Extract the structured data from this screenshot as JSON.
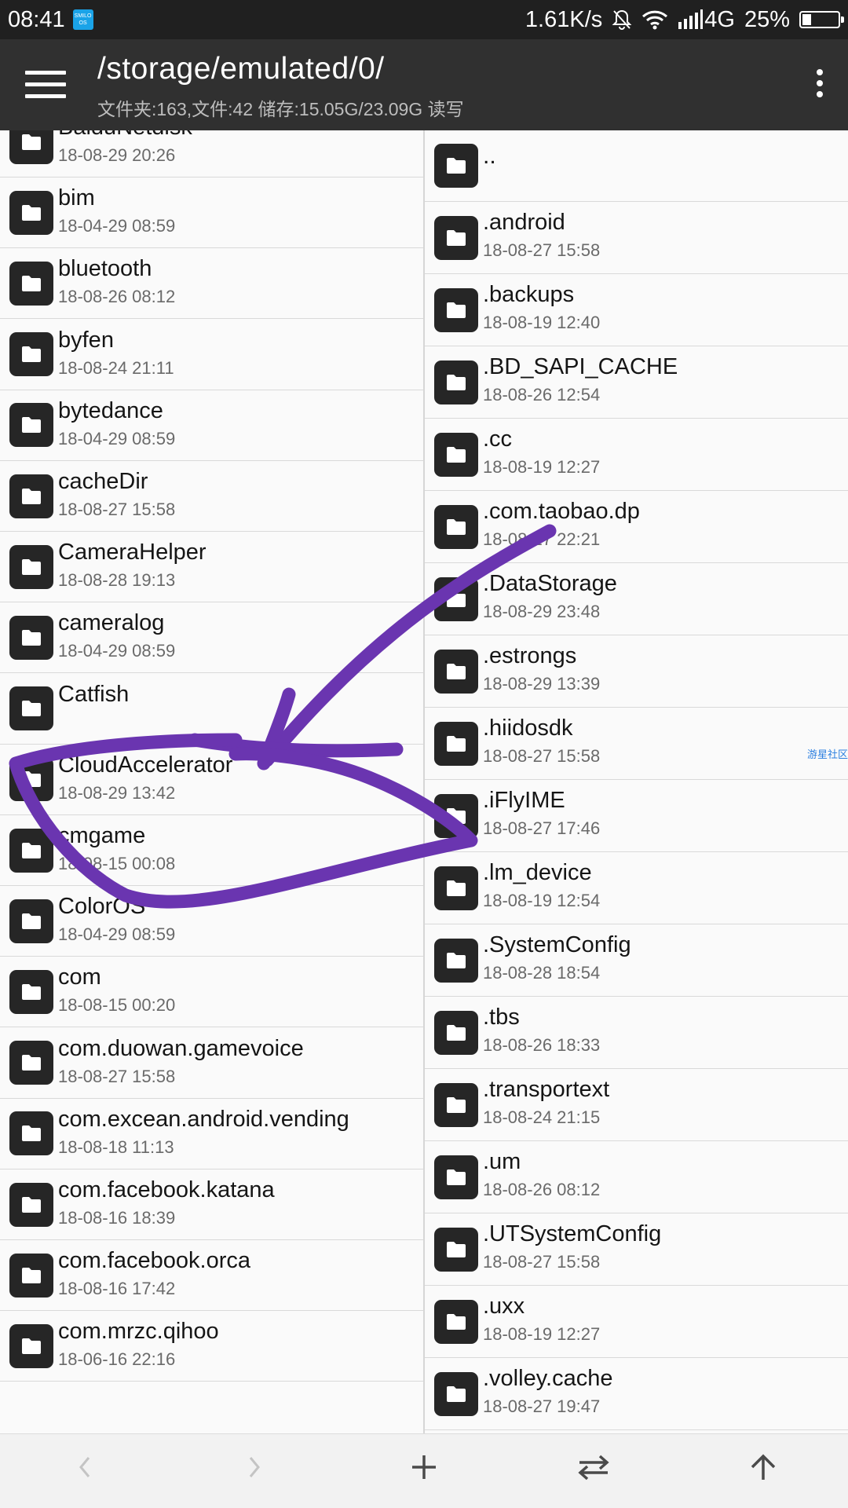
{
  "status_bar": {
    "time": "08:41",
    "os_badge": "SMILO OS",
    "speed": "1.61K/s",
    "network": "4G",
    "battery_percent": "25%",
    "battery_level": 0.25,
    "icons": [
      "mute-bell-icon",
      "wifi-icon",
      "signal-icon",
      "battery-icon"
    ]
  },
  "app_bar": {
    "path": "/storage/emulated/0/",
    "info": "文件夹:163,文件:42  储存:15.05G/23.09G  读写",
    "icons": [
      "menu-icon",
      "more-vert-icon"
    ]
  },
  "left_pane": {
    "items": [
      {
        "name": "BaiduNetdisk",
        "date": "18-08-29 20:26"
      },
      {
        "name": "bim",
        "date": "18-04-29 08:59"
      },
      {
        "name": "bluetooth",
        "date": "18-08-26 08:12"
      },
      {
        "name": "byfen",
        "date": "18-08-24 21:11"
      },
      {
        "name": "bytedance",
        "date": "18-04-29 08:59"
      },
      {
        "name": "cacheDir",
        "date": "18-08-27 15:58"
      },
      {
        "name": "CameraHelper",
        "date": "18-08-28 19:13"
      },
      {
        "name": "cameralog",
        "date": "18-04-29 08:59"
      },
      {
        "name": "Catfish",
        "date": ""
      },
      {
        "name": "CloudAccelerator",
        "date": "18-08-29 13:42"
      },
      {
        "name": "cmgame",
        "date": "18-08-15 00:08"
      },
      {
        "name": "ColorOS",
        "date": "18-04-29 08:59"
      },
      {
        "name": "com",
        "date": "18-08-15 00:20"
      },
      {
        "name": "com.duowan.gamevoice",
        "date": "18-08-27 15:58"
      },
      {
        "name": "com.excean.android.vending",
        "date": "18-08-18 11:13"
      },
      {
        "name": "com.facebook.katana",
        "date": "18-08-16 18:39"
      },
      {
        "name": "com.facebook.orca",
        "date": "18-08-16 17:42"
      },
      {
        "name": "com.mrzc.qihoo",
        "date": "18-06-16 22:16"
      }
    ]
  },
  "right_pane": {
    "parent": "..",
    "items": [
      {
        "name": ".android",
        "date": "18-08-27 15:58"
      },
      {
        "name": ".backups",
        "date": "18-08-19 12:40"
      },
      {
        "name": ".BD_SAPI_CACHE",
        "date": "18-08-26 12:54"
      },
      {
        "name": ".cc",
        "date": "18-08-19 12:27"
      },
      {
        "name": ".com.taobao.dp",
        "date": "18-08-27 22:21"
      },
      {
        "name": ".DataStorage",
        "date": "18-08-29 23:48"
      },
      {
        "name": ".estrongs",
        "date": "18-08-29 13:39"
      },
      {
        "name": ".hiidosdk",
        "date": "18-08-27 15:58"
      },
      {
        "name": ".iFlyIME",
        "date": "18-08-27 17:46"
      },
      {
        "name": ".lm_device",
        "date": "18-08-19 12:54"
      },
      {
        "name": ".SystemConfig",
        "date": "18-08-28 18:54"
      },
      {
        "name": ".tbs",
        "date": "18-08-26 18:33"
      },
      {
        "name": ".transportext",
        "date": "18-08-24 21:15"
      },
      {
        "name": ".um",
        "date": "18-08-26 08:12"
      },
      {
        "name": ".UTSystemConfig",
        "date": "18-08-27 15:58"
      },
      {
        "name": ".uxx",
        "date": "18-08-19 12:27"
      },
      {
        "name": ".volley.cache",
        "date": "18-08-27 19:47"
      }
    ]
  },
  "watermark": "游星社区",
  "bottom_bar": {
    "buttons": [
      "back-arrow-icon",
      "forward-arrow-icon",
      "add-icon",
      "swap-icon",
      "up-arrow-icon"
    ]
  },
  "colors": {
    "app_bar": "#303030",
    "status_bar": "#202020",
    "annotation_stroke": "#6a35b0",
    "folder_icon": "#262626"
  }
}
